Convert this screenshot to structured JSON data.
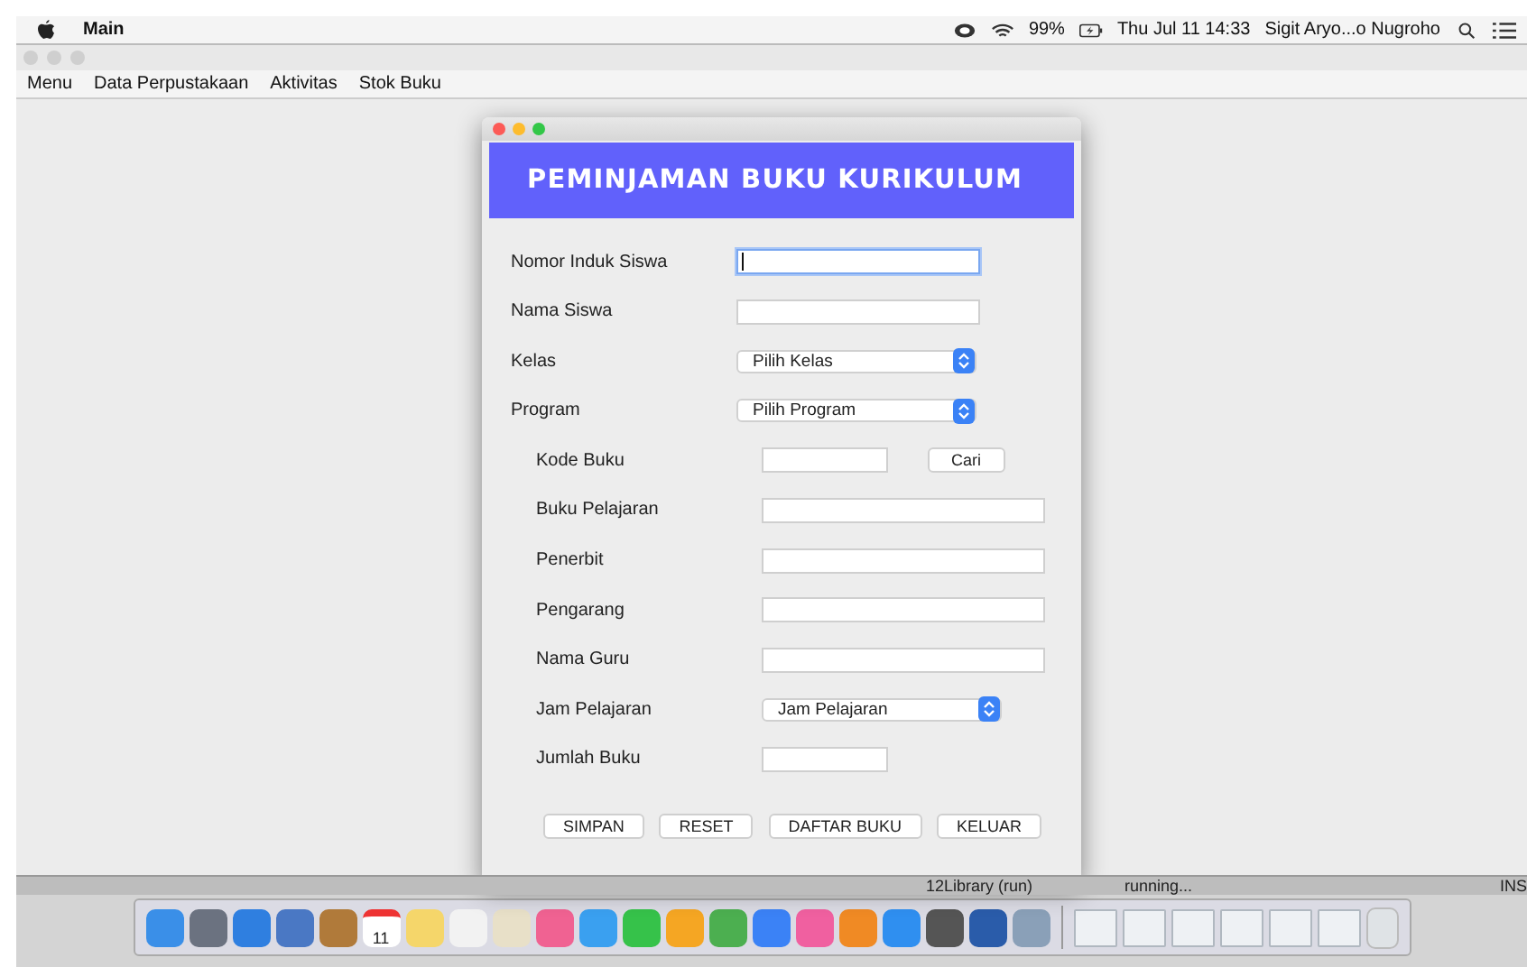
{
  "menu_bar": {
    "app_name": "Main",
    "battery": "99%",
    "clock": "Thu Jul 11  14:33",
    "user": "Sigit Aryo...o Nugroho"
  },
  "window": {
    "menu": [
      "Menu",
      "Data Perpustakaan",
      "Aktivitas",
      "Stok Buku"
    ]
  },
  "dialog": {
    "title": "PEMINJAMAN BUKU KURIKULUM",
    "student_fields": [
      {
        "label": "Nomor Induk Siswa",
        "kind": "text",
        "focused": true
      },
      {
        "label": "Nama Siswa",
        "kind": "text",
        "focused": false
      },
      {
        "label": "Kelas",
        "kind": "select",
        "value": "Pilih Kelas"
      },
      {
        "label": "Program",
        "kind": "select",
        "value": "Pilih Program"
      }
    ],
    "book_fields": [
      {
        "label": "Kode Buku",
        "kind": "search",
        "button": "Cari",
        "focused": false
      },
      {
        "label": "Buku Pelajaran",
        "kind": "text",
        "focused": false
      },
      {
        "label": "Penerbit",
        "kind": "text",
        "focused": false
      },
      {
        "label": "Pengarang",
        "kind": "text",
        "focused": false
      },
      {
        "label": "Nama Guru",
        "kind": "text",
        "focused": false
      },
      {
        "label": "Jam Pelajaran",
        "kind": "select",
        "value": "Jam Pelajaran"
      },
      {
        "label": "Jumlah Buku",
        "kind": "short",
        "focused": false
      }
    ],
    "buttons": [
      "SIMPAN",
      "RESET",
      "DAFTAR BUKU",
      "KELUAR"
    ]
  },
  "status_strip": {
    "task": "12Library (run)",
    "state": "running...",
    "mode": "INS"
  },
  "dock": {
    "calendar_day": "11"
  }
}
